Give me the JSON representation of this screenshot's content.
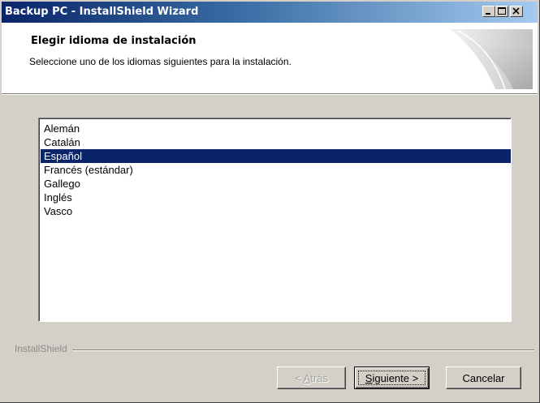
{
  "window": {
    "title": "Backup PC - InstallShield Wizard"
  },
  "header": {
    "title": "Elegir idioma de instalación",
    "subtitle": "Seleccione uno de los idiomas siguientes para la instalación."
  },
  "languages": {
    "items": [
      "Alemán",
      "Catalán",
      "Español",
      "Francés (estándar)",
      "Gallego",
      "Inglés",
      "Vasco"
    ],
    "selected": "Español"
  },
  "footer": {
    "brand": "InstallShield",
    "back_mnemonic": "A",
    "back_rest": "trás",
    "back_prefix": "< ",
    "next_mnemonic": "S",
    "next_rest": "iguiente >",
    "cancel_label": "Cancelar"
  },
  "colors": {
    "title_gradient_start": "#0a246a",
    "title_gradient_end": "#a6caf0",
    "selection": "#0a246a",
    "dialog_face": "#d4d0c8"
  },
  "icons": {
    "minimize": "minimize-icon",
    "maximize": "maximize-icon",
    "close": "close-icon",
    "header_art": "wizard-swoosh-graphic"
  }
}
